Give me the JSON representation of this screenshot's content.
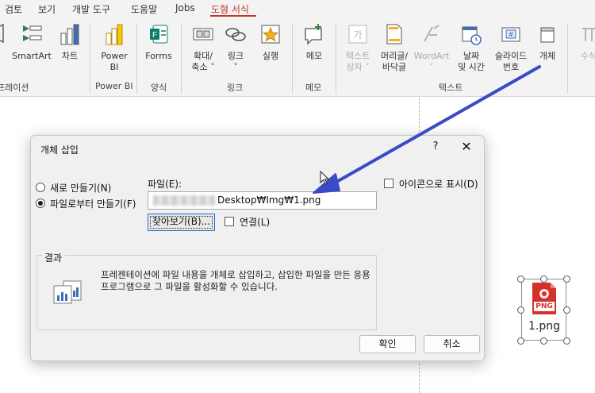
{
  "menu": {
    "tabs": [
      "검토",
      "보기",
      "개발 도구",
      "도움말",
      "Jobs",
      "도형 서식"
    ],
    "active_tab": "도형 서식",
    "active_color": "#c0392b"
  },
  "ribbon": {
    "buttons": {
      "smartart": "SmartArt",
      "chart": "차트",
      "powerbi_1": "Power",
      "powerbi_2": "BI",
      "forms": "Forms",
      "zoom_1": "확대/",
      "zoom_2": "축소 ˅",
      "link_1": "링크",
      "link_2": "˅",
      "action": "실행",
      "memo": "메모",
      "textbox_1": "텍스트",
      "textbox_2": "상자 ˅",
      "header_1": "머리글/",
      "header_2": "바닥글",
      "wordart_1": "WordArt",
      "wordart_2": "˅",
      "datetime_1": "날짜",
      "datetime_2": "및 시간",
      "slidenum_1": "슬라이드",
      "slidenum_2": "번호",
      "object": "개체",
      "equation": "수식"
    },
    "groups": {
      "illustrations": "프레이션",
      "powerbi": "Power BI",
      "forms": "양식",
      "links": "링크",
      "comments": "메모",
      "text": "텍스트"
    }
  },
  "dialog": {
    "title": "개체 삽입",
    "help": "?",
    "close": "✕",
    "radio_new": "새로 만들기(N)",
    "radio_from_file": "파일로부터 만들기(F)",
    "file_label": "파일(E):",
    "file_value": "Desktop₩Img₩1.png",
    "browse": "찾아보기(B)...",
    "link": "연결(L)",
    "display_icon": "아이콘으로 표시(D)",
    "result_label": "결과",
    "result_text": "프레젠테이션에 파일 내용을 개체로 삽입하고, 삽입한 파일을 만든 응용 프로그램으로 그 파일을 활성화할 수 있습니다.",
    "ok": "확인",
    "cancel": "취소"
  },
  "slide_object": {
    "icon_text": "PNG",
    "label": "1.png"
  },
  "colors": {
    "accent": "#1f6fd1",
    "annotation_arrow": "#3a4bc7",
    "png_icon": "#d3312b"
  }
}
